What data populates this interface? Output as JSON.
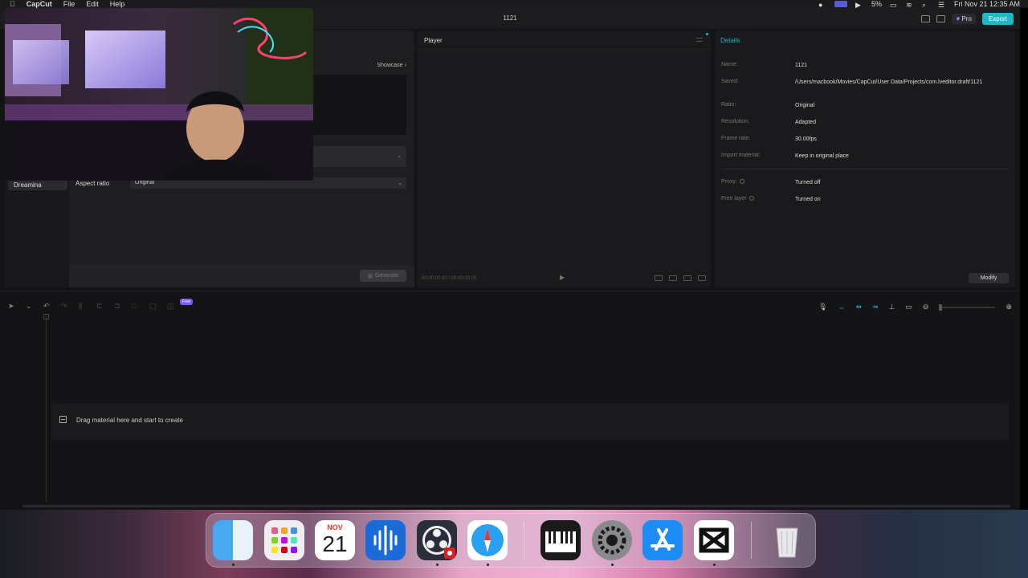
{
  "menubar": {
    "app_name": "CapCut",
    "menus": [
      "File",
      "Edit",
      "Help"
    ],
    "battery": "5%",
    "clock": "Fri Nov 21  12:35 AM"
  },
  "window": {
    "title": "1121",
    "pro_label": "Pro",
    "export_label": "Export"
  },
  "left_panel": {
    "showcase_label": "Showcase",
    "sidebar_item": "Dreamina",
    "aspect_label": "Aspect ratio",
    "aspect_value": "Original",
    "generate_label": "Generate"
  },
  "player": {
    "title": "Player",
    "timecode": "00:00:00:00 / 00:00:00:00"
  },
  "details": {
    "title": "Details",
    "rows": [
      {
        "label": "Name:",
        "value": "1121"
      },
      {
        "label": "Saved:",
        "value": "/Users/macbook/Movies/CapCut/User Data/Projects/com.lveditor.draft/1121"
      },
      {
        "label": "Ratio:",
        "value": "Original"
      },
      {
        "label": "Resolution:",
        "value": "Adapted"
      },
      {
        "label": "Frame rate:",
        "value": "30.00fps"
      },
      {
        "label": "Import material:",
        "value": "Keep in original place"
      },
      {
        "label": "Proxy:",
        "value": "Turned off"
      },
      {
        "label": "Free layer",
        "value": "Turned on"
      }
    ],
    "modify_label": "Modify"
  },
  "timeline": {
    "free_badge": "Free",
    "drop_text": "Drag material here and start to create"
  },
  "dock": {
    "calendar_month": "NOV",
    "calendar_day": "21",
    "apps": [
      "Finder",
      "Launchpad",
      "Calendar",
      "Audio",
      "OBS",
      "Safari",
      "Piano",
      "System Settings",
      "App Store",
      "CapCut",
      "Trash"
    ]
  },
  "colors": {
    "accent": "#1fb8c4",
    "free_badge": "#7a5af8",
    "background": "#141416"
  }
}
